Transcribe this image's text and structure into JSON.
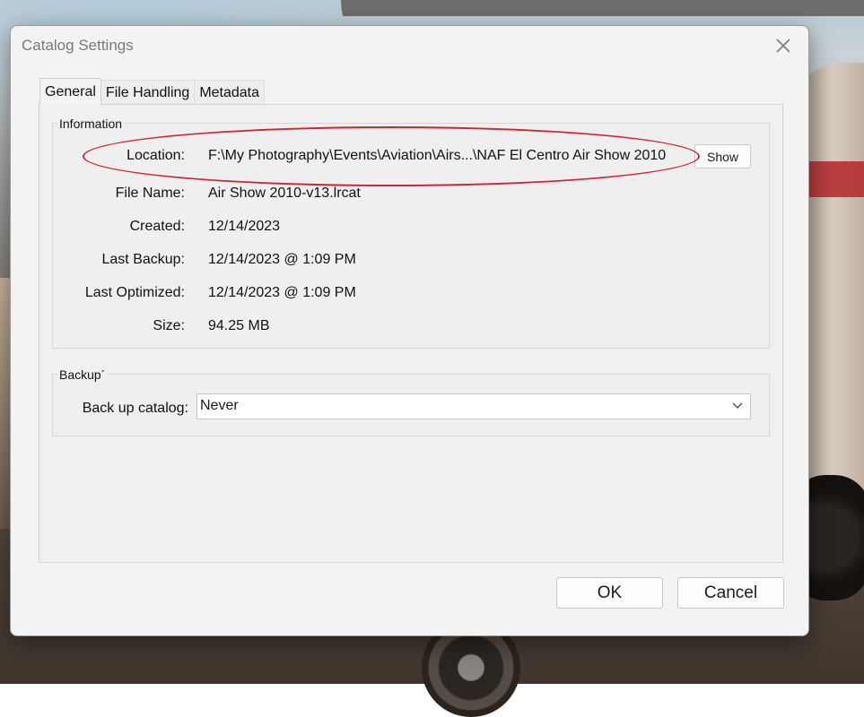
{
  "dialog": {
    "title": "Catalog Settings",
    "close_icon": "close-icon"
  },
  "tabs": [
    {
      "label": "General",
      "active": true
    },
    {
      "label": "File Handling",
      "active": false
    },
    {
      "label": "Metadata",
      "active": false
    }
  ],
  "information": {
    "group_label": "Information",
    "rows": [
      {
        "label": "Location:",
        "value": "F:\\My Photography\\Events\\Aviation\\Airs...\\NAF El Centro Air Show 2010"
      },
      {
        "label": "File Name:",
        "value": "Air Show 2010-v13.lrcat"
      },
      {
        "label": "Created:",
        "value": "12/14/2023"
      },
      {
        "label": "Last Backup:",
        "value": "12/14/2023 @ 1:09 PM"
      },
      {
        "label": "Last Optimized:",
        "value": "12/14/2023 @ 1:09 PM"
      },
      {
        "label": "Size:",
        "value": "94.25 MB"
      }
    ],
    "show_button": "Show"
  },
  "backup": {
    "group_label": "Backup´",
    "field_label": "Back up catalog:",
    "selected_value": "Never"
  },
  "buttons": {
    "ok": "OK",
    "cancel": "Cancel"
  },
  "annotation": {
    "highlight_color": "#d3242f"
  }
}
